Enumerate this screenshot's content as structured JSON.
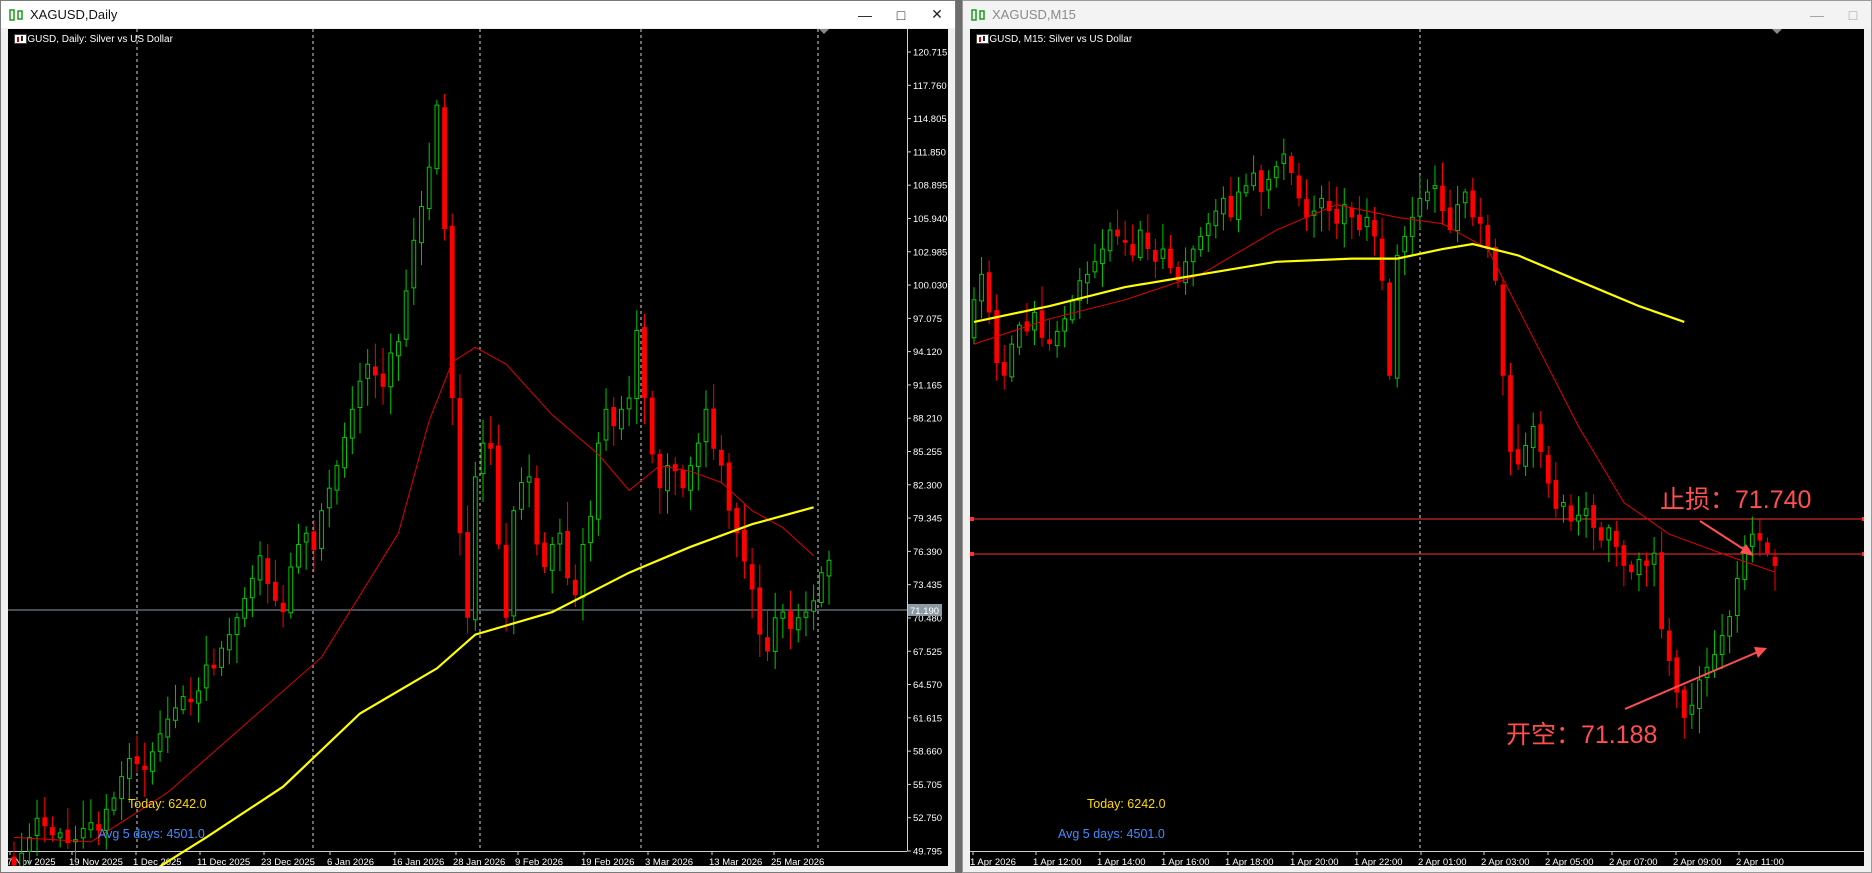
{
  "left_window": {
    "title": "XAGUSD,Daily",
    "chart_header": "XAGUSD, Daily:  Silver vs US Dollar",
    "today_label": "Today: 6242.0",
    "avg_label": "Avg 5 days: 4501.0",
    "price_badge": "71.190",
    "buttons": {
      "minimize": "—",
      "maximize": "□",
      "close": "✕"
    }
  },
  "right_window": {
    "title": "XAGUSD,M15",
    "chart_header": "XAGUSD, M15:  Silver vs US Dollar",
    "today_label": "Today: 6242.0",
    "avg_label": "Avg 5 days: 4501.0",
    "stop_loss_label": "止损：71.740",
    "entry_label": "开空：71.188",
    "buttons": {
      "minimize": "—",
      "maximize": "□"
    }
  },
  "colors": {
    "bull_candle": "#00c800",
    "bear_candle": "#ff0000",
    "ma_fast": "#e00000",
    "ma_slow": "#ffff00",
    "annotation": "#ff4f4f",
    "stop_line": "#ff3030",
    "today_text": "#ffd800",
    "avg_text": "#3f8dff"
  },
  "chart_data": [
    {
      "type": "candlestick",
      "symbol": "XAGUSD",
      "timeframe": "Daily",
      "y_ticks": [
        "120.715",
        "117.760",
        "114.805",
        "111.850",
        "108.895",
        "105.940",
        "102.985",
        "100.030",
        "97.075",
        "94.120",
        "91.165",
        "88.210",
        "85.255",
        "82.300",
        "79.345",
        "76.390",
        "73.435",
        "70.480",
        "67.525",
        "64.570",
        "61.615",
        "58.660",
        "55.705",
        "52.750",
        "49.795"
      ],
      "x_ticks": [
        "7 Nov 2025",
        "19 Nov 2025",
        "1 Dec 2025",
        "11 Dec 2025",
        "23 Dec 2025",
        "6 Jan 2026",
        "16 Jan 2026",
        "28 Jan 2026",
        "9 Feb 2026",
        "19 Feb 2026",
        "3 Mar 2026",
        "13 Mar 2026",
        "25 Mar 2026"
      ],
      "horizontal_line": 71.19,
      "closes": [
        48.5,
        49.6,
        51.0,
        52.7,
        52.0,
        51.2,
        51.4,
        50.5,
        50.8,
        51.8,
        52.3,
        51.6,
        53.5,
        54.5,
        56.4,
        58.0,
        57.5,
        57.0,
        58.6,
        60.2,
        61.5,
        62.5,
        63.5,
        63.0,
        64.0,
        66.3,
        66.0,
        67.8,
        69.0,
        70.5,
        72.2,
        74.0,
        76.0,
        73.5,
        72.0,
        71.0,
        75.0,
        77.0,
        78.0,
        76.5,
        80.0,
        82.0,
        84.0,
        86.5,
        89.0,
        91.5,
        93.0,
        92.0,
        91.0,
        94.0,
        95.0,
        99.5,
        104.0,
        107.0,
        110.5,
        116.0,
        105.0,
        90.0,
        78.0,
        70.5,
        83.0,
        86.0,
        85.5,
        77.0,
        70.5,
        80.0,
        82.5,
        83.0,
        77.0,
        75.0,
        77.0,
        78.0,
        74.0,
        72.5,
        77.0,
        79.5,
        86.0,
        89.0,
        87.5,
        89.0,
        90.0,
        96.0,
        90.0,
        85.0,
        82.0,
        84.0,
        83.5,
        82.0,
        84.0,
        86.0,
        89.0,
        85.5,
        84.0,
        80.0,
        78.0,
        75.5,
        73.0,
        69.0,
        67.5,
        70.5,
        71.0,
        69.5,
        70.5,
        71.0,
        72.0,
        74.5,
        75.6
      ],
      "ma_fast_points": [
        [
          0,
          51.0
        ],
        [
          10,
          50.6
        ],
        [
          20,
          55.0
        ],
        [
          30,
          61.0
        ],
        [
          40,
          67.0
        ],
        [
          50,
          78.0
        ],
        [
          54,
          88.0
        ],
        [
          57,
          93.2
        ],
        [
          60,
          94.5
        ],
        [
          64,
          93.0
        ],
        [
          70,
          88.5
        ],
        [
          76,
          85.0
        ],
        [
          80,
          81.8
        ],
        [
          84,
          84.0
        ],
        [
          88,
          83.5
        ],
        [
          92,
          82.5
        ],
        [
          96,
          80.0
        ],
        [
          100,
          78.5
        ],
        [
          104,
          76.0
        ]
      ],
      "ma_slow_points": [
        [
          18,
          48.0
        ],
        [
          25,
          51.0
        ],
        [
          35,
          55.5
        ],
        [
          45,
          62.0
        ],
        [
          55,
          66.0
        ],
        [
          60,
          69.0
        ],
        [
          70,
          71.0
        ],
        [
          80,
          74.5
        ],
        [
          88,
          76.8
        ],
        [
          96,
          78.8
        ],
        [
          104,
          80.3
        ]
      ]
    },
    {
      "type": "candlestick",
      "symbol": "XAGUSD",
      "timeframe": "M15",
      "x_ticks": [
        "1 Apr 2026",
        "1 Apr 12:00",
        "1 Apr 14:00",
        "1 Apr 16:00",
        "1 Apr 18:00",
        "1 Apr 20:00",
        "1 Apr 22:00",
        "2 Apr 01:00",
        "2 Apr 03:00",
        "2 Apr 05:00",
        "2 Apr 07:00",
        "2 Apr 09:00",
        "2 Apr 11:00"
      ],
      "stop_loss": 71.74,
      "entry": 71.188,
      "closes": [
        75.2,
        75.6,
        75.0,
        74.2,
        74.0,
        74.5,
        74.8,
        74.7,
        75.0,
        74.6,
        74.5,
        74.7,
        74.9,
        75.2,
        75.5,
        75.6,
        75.8,
        76.0,
        76.3,
        76.2,
        76.1,
        75.9,
        76.3,
        76.0,
        75.8,
        76.0,
        75.7,
        75.5,
        75.8,
        76.0,
        76.2,
        76.4,
        76.6,
        76.8,
        76.5,
        76.9,
        77.0,
        77.2,
        76.9,
        77.1,
        77.3,
        77.5,
        77.2,
        76.8,
        76.5,
        76.6,
        76.8,
        76.6,
        76.4,
        76.7,
        76.5,
        76.3,
        76.5,
        76.2,
        75.5,
        74.0,
        75.9,
        76.2,
        76.5,
        76.8,
        76.9,
        77.0,
        76.6,
        76.3,
        76.7,
        76.9,
        76.5,
        76.4,
        76.0,
        75.5,
        74.0,
        72.8,
        72.6,
        72.9,
        73.2,
        72.8,
        72.3,
        71.9,
        72.0,
        71.7,
        71.8,
        71.9,
        71.6,
        71.4,
        71.6,
        71.3,
        71.0,
        70.9,
        71.1,
        71.0,
        71.2,
        70.0,
        69.5,
        69.0,
        68.6,
        68.8,
        69.2,
        69.4,
        69.6,
        69.9,
        70.2,
        70.8,
        71.3,
        71.5,
        71.4,
        71.2,
        71.0
      ],
      "ma_fast_points": [
        [
          0,
          74.5
        ],
        [
          10,
          74.9
        ],
        [
          20,
          75.2
        ],
        [
          30,
          75.6
        ],
        [
          40,
          76.3
        ],
        [
          48,
          76.7
        ],
        [
          56,
          76.5
        ],
        [
          62,
          76.4
        ],
        [
          68,
          76.0
        ],
        [
          74,
          74.6
        ],
        [
          80,
          73.2
        ],
        [
          86,
          72.0
        ],
        [
          92,
          71.5
        ],
        [
          100,
          71.15
        ],
        [
          106,
          70.9
        ]
      ],
      "ma_slow_points": [
        [
          0,
          74.85
        ],
        [
          10,
          75.1
        ],
        [
          20,
          75.4
        ],
        [
          30,
          75.6
        ],
        [
          40,
          75.8
        ],
        [
          50,
          75.85
        ],
        [
          56,
          75.85
        ],
        [
          62,
          76.0
        ],
        [
          66,
          76.08
        ],
        [
          72,
          75.9
        ],
        [
          80,
          75.5
        ],
        [
          88,
          75.1
        ],
        [
          94,
          74.85
        ]
      ]
    }
  ]
}
